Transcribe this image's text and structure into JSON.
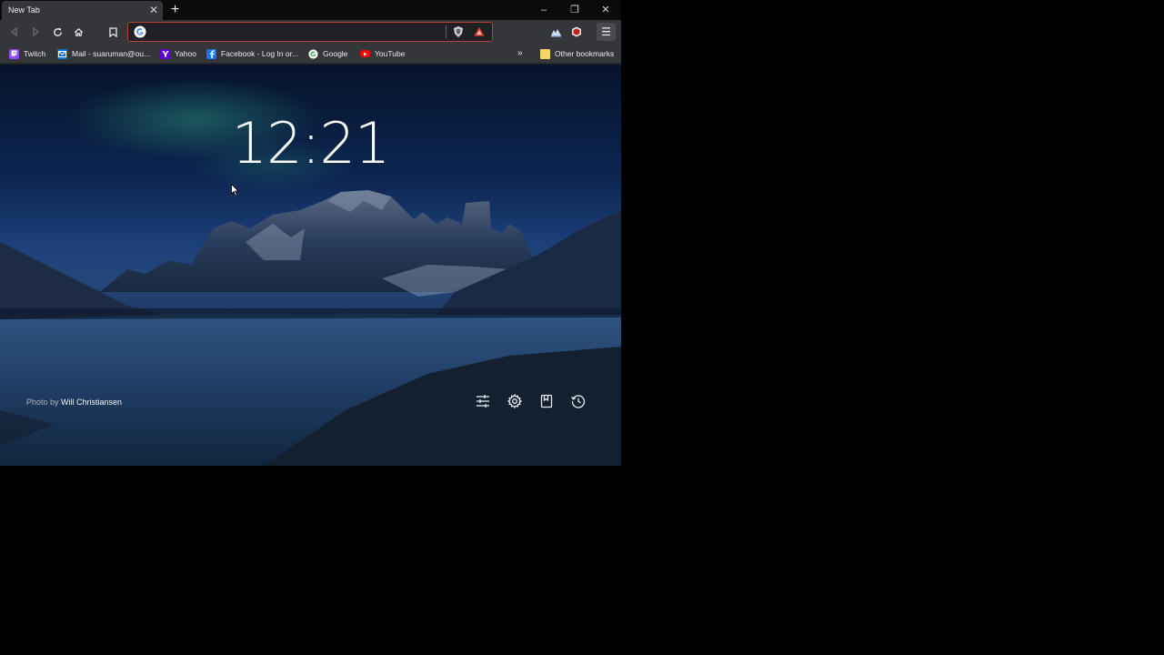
{
  "browser": {
    "tab_title": "New Tab",
    "tab_close": "✕",
    "new_tab": "+",
    "window_controls": {
      "minimize": "–",
      "restore": "❐",
      "close": "✕"
    },
    "menu": "☰",
    "omnibox": {
      "value": "",
      "placeholder": ""
    }
  },
  "bookmarks": {
    "items": [
      {
        "label": "Twitch",
        "icon": "twitch-icon",
        "color": "#9146ff"
      },
      {
        "label": "Mail - suaruman@ou...",
        "icon": "outlook-icon",
        "color": "#0078d4"
      },
      {
        "label": "Yahoo",
        "icon": "yahoo-icon",
        "color": "#6001d2"
      },
      {
        "label": "Facebook - Log In or...",
        "icon": "facebook-icon",
        "color": "#1877f2"
      },
      {
        "label": "Google",
        "icon": "google-icon",
        "color": "#ffffff"
      },
      {
        "label": "YouTube",
        "icon": "youtube-icon",
        "color": "#ff0000"
      }
    ],
    "overflow": "»",
    "other_label": "Other bookmarks"
  },
  "newtab": {
    "clock": "12:21",
    "photo_credit_prefix": "Photo by",
    "photo_credit_author": "Will Christiansen"
  }
}
